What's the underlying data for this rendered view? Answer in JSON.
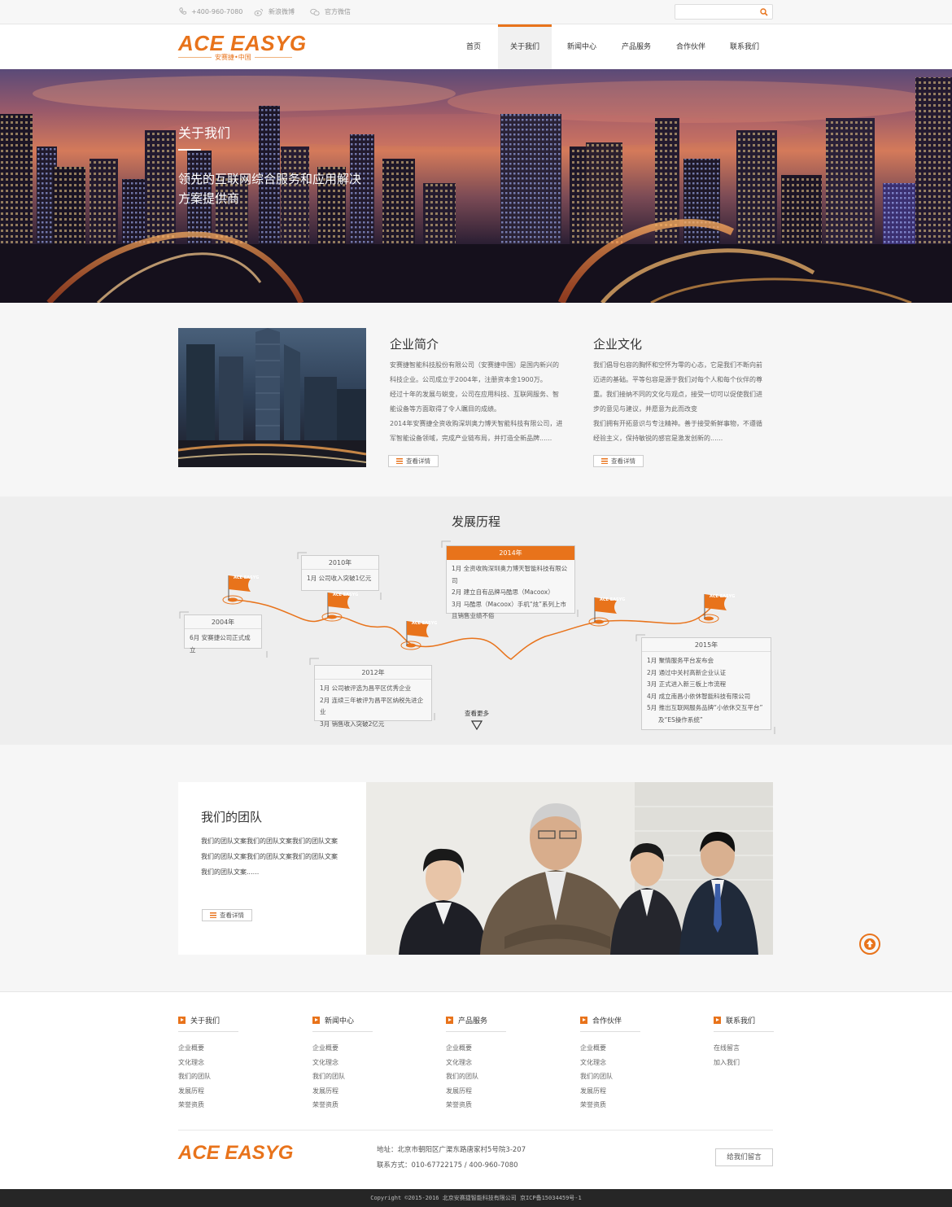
{
  "topbar": {
    "phone": "+400-960-7080",
    "weibo": "新浪微博",
    "wechat": "官方微信",
    "search_placeholder": ""
  },
  "brand": {
    "logo_text": "ACE EASYG",
    "logo_sub": "安赛捷•中国",
    "accent_color": "#e8731b"
  },
  "nav": {
    "items": [
      {
        "label": "首页"
      },
      {
        "label": "关于我们"
      },
      {
        "label": "新闻中心"
      },
      {
        "label": "产品服务"
      },
      {
        "label": "合作伙伴"
      },
      {
        "label": "联系我们"
      }
    ],
    "active_label": "关于我们"
  },
  "hero": {
    "title": "关于我们",
    "desc_line1": "领先的互联网综合服务和应用解决",
    "desc_line2": "方案提供商"
  },
  "intro": {
    "about_title": "企业简介",
    "about_lines": [
      "安赛捷智能科技股份有限公司（安赛捷中国）是国内新兴的",
      "科技企业。公司成立于2004年，注册资本金1900万。",
      "经过十年的发展与蜕变，公司在应用科技、互联网服务、智",
      "能设备等方面取得了令人瞩目的成绩。",
      "2014年安赛捷全资收购深圳奥力博天智能科技有限公司，进",
      "军智能设备领域，完成产业链布局，并打造全新品牌......"
    ],
    "about_btn": "查看详情",
    "culture_title": "企业文化",
    "culture_lines": [
      "我们倡导包容的胸怀和空怀为零的心态，它是我们不断向前",
      "迈进的基础。平等包容是源于我们对每个人和每个伙伴的尊",
      "重。我们接纳不同的文化与观点，接受一切可以促使我们进",
      "步的意见与建议，并愿意为此而改变",
      "我们拥有开拓意识与专注精神。善于接受新鲜事物，不遵循",
      "经验主义，保持敏锐的感官是激发创新的......"
    ],
    "culture_btn": "查看详情"
  },
  "history": {
    "title": "发展历程",
    "flag_text": "ACE EASYG",
    "cards": [
      {
        "year": "2004年",
        "items": [
          "6月 安赛捷公司正式成立"
        ]
      },
      {
        "year": "2010年",
        "items": [
          "1月 公司收入突破1亿元"
        ]
      },
      {
        "year": "2012年",
        "items": [
          "1月 公司被评选为昌平区优秀企业",
          "2月 连续三年被评为昌平区纳税先进企业",
          "3月 销售收入突破2亿元"
        ]
      },
      {
        "year": "2014年",
        "items": [
          "1月 全资收购深圳奥力博天智能科技有限公司",
          "2月 建立自有品牌马酷思（Macoox）",
          "3月 马酷思（Macoox）手机“炫”系列上市",
          "且销售业绩不俗"
        ]
      },
      {
        "year": "2015年",
        "items": [
          "1月 聚情服务平台发布会",
          "2月 通过中关村高新企业认证",
          "3月 正式进入新三板上市流程",
          "4月 成立南昌小依休智能科技有限公司",
          "5月 推出互联网服务品牌“小依休交互平台”",
          "及“ES操作系统”"
        ]
      }
    ],
    "view_more": "查看更多"
  },
  "team": {
    "title": "我们的团队",
    "lines": [
      "我们的团队文案我们的团队文案我们的团队文案",
      "我们的团队文案我们的团队文案我们的团队文案",
      "我们的团队文案......"
    ],
    "btn": "查看详情"
  },
  "footer": {
    "columns": [
      {
        "title": "关于我们",
        "links": [
          "企业概要",
          "文化理念",
          "我们的团队",
          "发展历程",
          "荣誉资质"
        ]
      },
      {
        "title": "新闻中心",
        "links": [
          "企业概要",
          "文化理念",
          "我们的团队",
          "发展历程",
          "荣誉资质"
        ]
      },
      {
        "title": "产品服务",
        "links": [
          "企业概要",
          "文化理念",
          "我们的团队",
          "发展历程",
          "荣誉资质"
        ]
      },
      {
        "title": "合作伙伴",
        "links": [
          "企业概要",
          "文化理念",
          "我们的团队",
          "发展历程",
          "荣誉资质"
        ]
      },
      {
        "title": "联系我们",
        "links": [
          "在线留言",
          "加入我们"
        ]
      }
    ],
    "logo_text": "ACE EASYG",
    "address": "地址：北京市朝阳区广渠东路唐家村5号院3-207",
    "contact": "联系方式：010-67722175 / 400-960-7080",
    "message_btn": "给我们留言",
    "copyright": "Copyright ©2015-2016 北京安赛捷智能科技有限公司 京ICP备15034459号-1"
  }
}
